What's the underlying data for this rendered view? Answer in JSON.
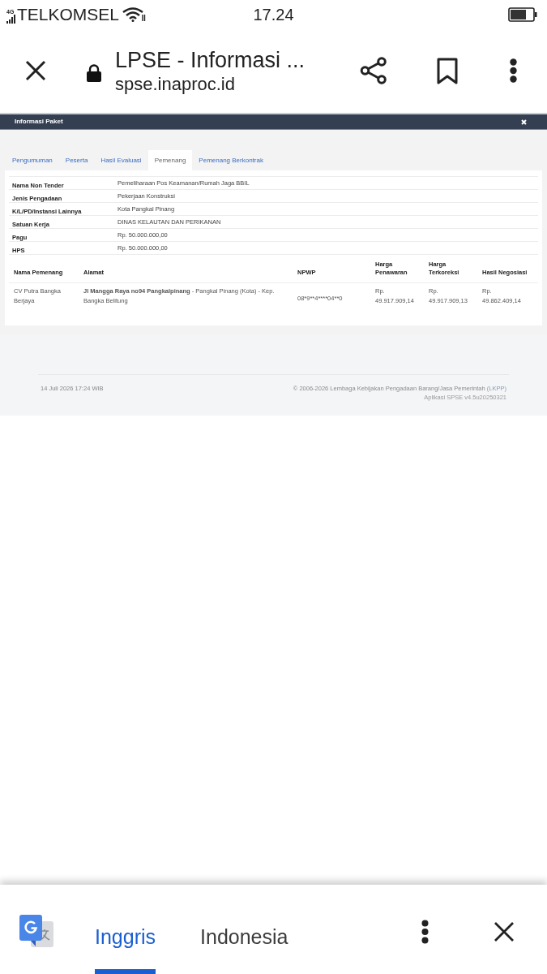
{
  "status_bar": {
    "network": "4G",
    "carrier": "TELKOMSEL",
    "time": "17.24"
  },
  "browser_bar": {
    "title": "LPSE - Informasi ...",
    "url": "spse.inaproc.id"
  },
  "dialog": {
    "title": "Informasi Paket"
  },
  "tabs": [
    {
      "label": "Pengumuman",
      "selected": false
    },
    {
      "label": "Peserta",
      "selected": false
    },
    {
      "label": "Hasil Evaluasi",
      "selected": false
    },
    {
      "label": "Pemenang",
      "selected": true
    },
    {
      "label": "Pemenang Berkontrak",
      "selected": false
    }
  ],
  "details": [
    {
      "label": "Nama Non Tender",
      "value": "Pemeliharaan Pos Keamanan/Rumah Jaga BBIL"
    },
    {
      "label": "Jenis Pengadaan",
      "value": "Pekerjaan Konstruksi"
    },
    {
      "label": "K/L/PD/Instansi Lainnya",
      "value": "Kota Pangkal Pinang"
    },
    {
      "label": "Satuan Kerja",
      "value": "DINAS KELAUTAN DAN PERIKANAN"
    },
    {
      "label": "Pagu",
      "value": "Rp. 50.000.000,00"
    },
    {
      "label": "HPS",
      "value": "Rp. 50.000.000,00"
    }
  ],
  "winners_table": {
    "columns": [
      "Nama Pemenang",
      "Alamat",
      "NPWP",
      "Harga Penawaran",
      "Harga Terkoreksi",
      "Hasil Negosiasi"
    ],
    "rows": [
      {
        "nama_pemenang": "CV Putra Bangka Berjaya",
        "alamat": "**Jl Mangga Raya no94 Pangkalpinang** - Pangkal Pinang (Kota) - Kep. Bangka Belitung",
        "npwp": "08*9**4****04**0",
        "harga_penawaran": "Rp. 49.917.909,14",
        "harga_terkoreksi": "Rp. 49.917.909,13",
        "hasil_negosiasi": "Rp. 49.862.409,14"
      }
    ]
  },
  "footer": {
    "date": "14 Juli 2026 17:24 WIB",
    "copyright": "© 2006-2026 Lembaga Kebijakan Pengadaan Barang/Jasa Pemerintah",
    "copyright_link": "(LKPP)",
    "version": "Aplikasi SPSE v4.5u20250321"
  },
  "translate_bar": {
    "languages": [
      {
        "label": "Inggris",
        "selected": true
      },
      {
        "label": "Indonesia",
        "selected": false
      }
    ]
  }
}
